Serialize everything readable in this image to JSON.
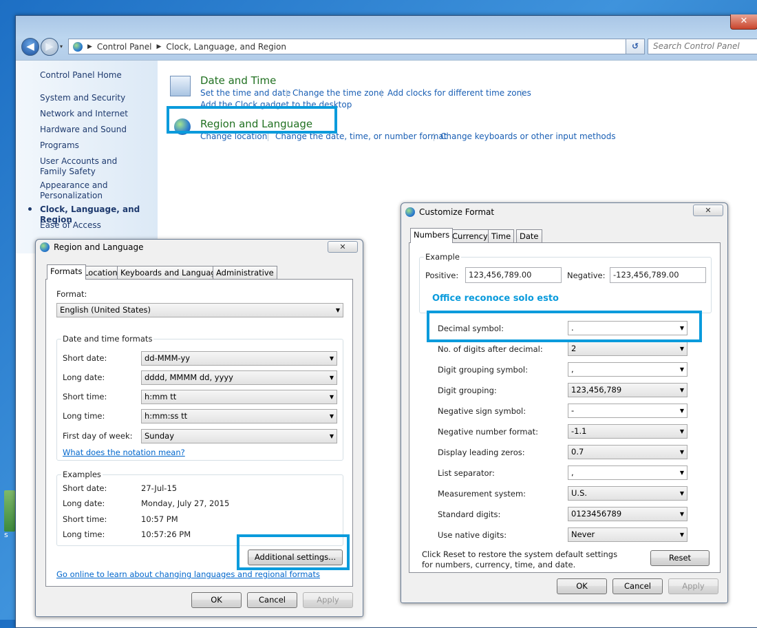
{
  "desktop": {
    "icon_label": "s"
  },
  "window": {
    "close_glyph": "✕"
  },
  "nav": {
    "back_glyph": "◀",
    "forward_glyph": "▶",
    "history_glyph": "▾",
    "refresh_glyph": "↺"
  },
  "address": {
    "crumbs": [
      "Control Panel",
      "Clock, Language, and Region"
    ],
    "search_placeholder": "Search Control Panel"
  },
  "sidebar": {
    "home": "Control Panel Home",
    "items": [
      "System and Security",
      "Network and Internet",
      "Hardware and Sound",
      "Programs",
      "User Accounts and Family Safety",
      "Appearance and Personalization",
      "Clock, Language, and Region",
      "Ease of Access"
    ],
    "active": "Clock, Language, and Region"
  },
  "categories": [
    {
      "title": "Date and Time",
      "links": [
        "Set the time and date",
        "Change the time zone",
        "Add clocks for different time zones",
        "Add the Clock gadget to the desktop"
      ]
    },
    {
      "title": "Region and Language",
      "links": [
        "Change location",
        "Change the date, time, or number format",
        "Change keyboards or other input methods"
      ]
    }
  ],
  "region_dialog": {
    "title": "Region and Language",
    "tabs": [
      "Formats",
      "Location",
      "Keyboards and Languages",
      "Administrative"
    ],
    "format_label": "Format:",
    "format_value": "English (United States)",
    "dt_group": "Date and time formats",
    "dt_rows": [
      {
        "label": "Short date:",
        "value": "dd-MMM-yy"
      },
      {
        "label": "Long date:",
        "value": "dddd, MMMM dd, yyyy"
      },
      {
        "label": "Short time:",
        "value": "h:mm tt"
      },
      {
        "label": "Long time:",
        "value": "h:mm:ss tt"
      },
      {
        "label": "First day of week:",
        "value": "Sunday"
      }
    ],
    "notation_link": "What does the notation mean?",
    "examples_group": "Examples",
    "examples": [
      {
        "label": "Short date:",
        "value": "27-Jul-15"
      },
      {
        "label": "Long date:",
        "value": "Monday, July 27, 2015"
      },
      {
        "label": "Short time:",
        "value": "10:57 PM"
      },
      {
        "label": "Long time:",
        "value": "10:57:26 PM"
      }
    ],
    "additional_btn": "Additional settings...",
    "online_link": "Go online to learn about changing languages and regional formats",
    "ok": "OK",
    "cancel": "Cancel",
    "apply": "Apply"
  },
  "customize_dialog": {
    "title": "Customize Format",
    "tabs": [
      "Numbers",
      "Currency",
      "Time",
      "Date"
    ],
    "example_group": "Example",
    "positive_label": "Positive:",
    "positive_value": "123,456,789.00",
    "negative_label": "Negative:",
    "negative_value": "-123,456,789.00",
    "annotation": "Office reconoce solo esto",
    "rows": [
      {
        "label": "Decimal symbol:",
        "value": "."
      },
      {
        "label": "No. of digits after decimal:",
        "value": "2"
      },
      {
        "label": "Digit grouping symbol:",
        "value": ","
      },
      {
        "label": "Digit grouping:",
        "value": "123,456,789"
      },
      {
        "label": "Negative sign symbol:",
        "value": "-"
      },
      {
        "label": "Negative number format:",
        "value": "-1.1"
      },
      {
        "label": "Display leading zeros:",
        "value": "0.7"
      },
      {
        "label": "List separator:",
        "value": ","
      },
      {
        "label": "Measurement system:",
        "value": "U.S."
      },
      {
        "label": "Standard digits:",
        "value": "0123456789"
      },
      {
        "label": "Use native digits:",
        "value": "Never"
      }
    ],
    "reset_text": "Click Reset to restore the system default settings for numbers, currency, time, and date.",
    "reset": "Reset",
    "ok": "OK",
    "cancel": "Cancel",
    "apply": "Apply"
  },
  "colors": {
    "highlight": "#0a9bdc",
    "link": "#1a5fb4",
    "category_title": "#207020"
  }
}
